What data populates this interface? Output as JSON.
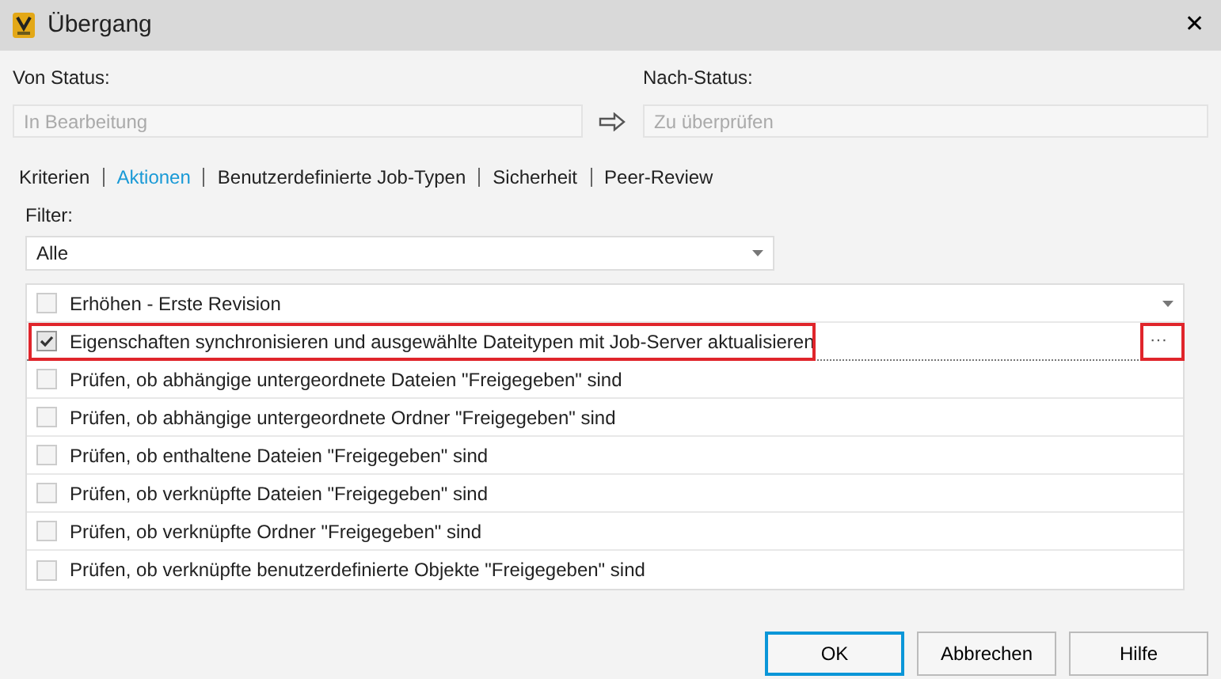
{
  "window": {
    "title": "Übergang",
    "close": "✕"
  },
  "from_status": {
    "label": "Von Status:",
    "placeholder": "In Bearbeitung"
  },
  "to_status": {
    "label": "Nach-Status:",
    "placeholder": "Zu überprüfen"
  },
  "tabs": [
    {
      "label": "Kriterien",
      "selected": false
    },
    {
      "label": "Aktionen",
      "selected": true
    },
    {
      "label": "Benutzerdefinierte Job-Typen",
      "selected": false
    },
    {
      "label": "Sicherheit",
      "selected": false
    },
    {
      "label": "Peer-Review",
      "selected": false
    }
  ],
  "filter": {
    "label": "Filter:",
    "value": "Alle"
  },
  "actions": [
    {
      "label": "Erhöhen - Erste Revision",
      "checked": false,
      "kind": "dropdown",
      "highlighted": false
    },
    {
      "label": "Eigenschaften synchronisieren und ausgewählte Dateitypen mit Job-Server aktualisieren",
      "checked": true,
      "kind": "options",
      "highlighted": true,
      "button": "···"
    },
    {
      "label": "Prüfen, ob abhängige untergeordnete Dateien \"Freigegeben\" sind",
      "checked": false,
      "kind": "plain",
      "highlighted": false
    },
    {
      "label": "Prüfen, ob abhängige untergeordnete Ordner \"Freigegeben\" sind",
      "checked": false,
      "kind": "plain",
      "highlighted": false
    },
    {
      "label": "Prüfen, ob enthaltene Dateien \"Freigegeben\" sind",
      "checked": false,
      "kind": "plain",
      "highlighted": false
    },
    {
      "label": "Prüfen, ob verknüpfte Dateien \"Freigegeben\" sind",
      "checked": false,
      "kind": "plain",
      "highlighted": false
    },
    {
      "label": "Prüfen, ob verknüpfte Ordner \"Freigegeben\" sind",
      "checked": false,
      "kind": "plain",
      "highlighted": false
    },
    {
      "label": "Prüfen, ob verknüpfte benutzerdefinierte Objekte \"Freigegeben\" sind",
      "checked": false,
      "kind": "plain",
      "highlighted": false
    }
  ],
  "buttons": [
    {
      "label": "OK",
      "default": true
    },
    {
      "label": "Abbrechen",
      "default": false
    },
    {
      "label": "Hilfe",
      "default": false
    }
  ]
}
